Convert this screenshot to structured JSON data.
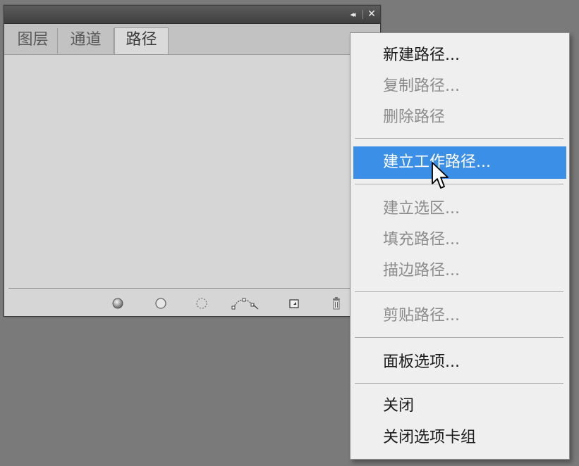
{
  "panel": {
    "titlebar": {
      "collapse_glyph": "◂◂",
      "close_glyph": "✕"
    },
    "tabs": [
      {
        "label": "图层"
      },
      {
        "label": "通道"
      },
      {
        "label": "路径"
      }
    ],
    "active_tab": "路径",
    "menu_button_glyph": "≡",
    "bottom_icons": [
      "fill-path-icon",
      "stroke-path-icon",
      "load-selection-icon",
      "make-work-path-icon",
      "new-path-icon",
      "delete-path-icon"
    ]
  },
  "menu": {
    "items": [
      {
        "label": "新建路径...",
        "enabled": true
      },
      {
        "label": "复制路径...",
        "enabled": false
      },
      {
        "label": "删除路径",
        "enabled": false
      },
      {
        "label": "建立工作路径...",
        "enabled": true,
        "highlighted": true
      },
      {
        "label": "建立选区...",
        "enabled": false
      },
      {
        "label": "填充路径...",
        "enabled": false
      },
      {
        "label": "描边路径...",
        "enabled": false
      },
      {
        "label": "剪贴路径...",
        "enabled": false
      },
      {
        "label": "面板选项...",
        "enabled": true
      },
      {
        "label": "关闭",
        "enabled": true
      },
      {
        "label": "关闭选项卡组",
        "enabled": true
      }
    ]
  },
  "colors": {
    "highlight": "#3c8fe6",
    "disabled_text": "#8c8c8c",
    "enabled_text": "#1b1b1b",
    "workspace": "#7a7a7a"
  }
}
